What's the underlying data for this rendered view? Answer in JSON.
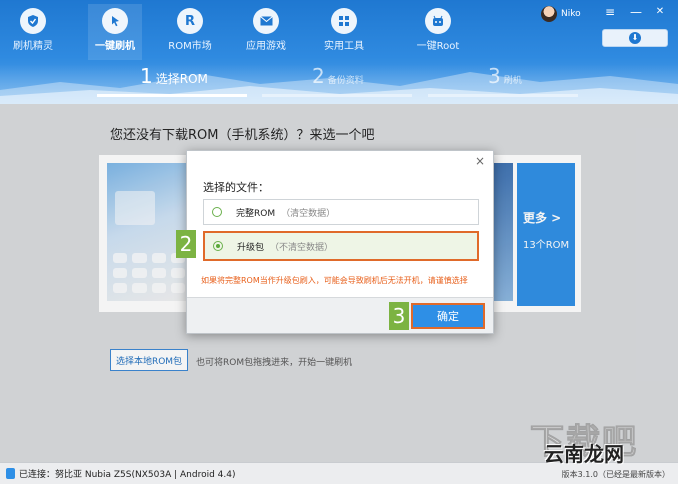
{
  "nav": {
    "items": [
      {
        "label": "刷机精灵",
        "icon": "shield-icon"
      },
      {
        "label": "一键刷机",
        "icon": "cursor-arrow-icon"
      },
      {
        "label": "ROM市场",
        "icon": "letter-r-icon"
      },
      {
        "label": "应用游戏",
        "icon": "mail-icon"
      },
      {
        "label": "实用工具",
        "icon": "grid-icon"
      },
      {
        "label": "一键Root",
        "icon": "robot-icon"
      }
    ],
    "active_index": 1
  },
  "user": {
    "name": "Niko"
  },
  "window": {
    "menu": "≡",
    "minimize": "—",
    "close": "✕",
    "download": "⬇"
  },
  "steps": [
    {
      "num": "1",
      "label": "选择ROM"
    },
    {
      "num": "2",
      "label": "备份资料"
    },
    {
      "num": "3",
      "label": "刷机"
    }
  ],
  "main": {
    "title": "您还没有下载ROM（手机系统）？来选一个吧",
    "more": {
      "label": "更多 >",
      "count": "13个ROM"
    },
    "local_button": "选择本地ROM包",
    "hint": "也可将ROM包拖拽进来，开始一键刷机"
  },
  "dialog": {
    "close": "×",
    "label": "选择的文件：",
    "options": [
      {
        "title": "完整ROM",
        "note": "（清空数据）",
        "selected": false
      },
      {
        "title": "升级包",
        "note": "（不清空数据）",
        "selected": true
      }
    ],
    "warning": "如果将完整ROM当作升级包刷入，可能会导致刷机后无法开机，请谨慎选择",
    "confirm": "确定",
    "markers": [
      "2",
      "3"
    ]
  },
  "status": {
    "connection": "已连接：努比亚 Nubia Z5S(NX503A | Android 4.4)",
    "version": "版本3.1.0（已经是最新版本）"
  },
  "watermark": {
    "big": "下载吧",
    "small": "云南龙网"
  },
  "colors": {
    "accent": "#2e8fe6",
    "header": "#1f78d1",
    "highlight": "#e06a2a",
    "marker": "#7cb342",
    "warning": "#e8601c"
  }
}
